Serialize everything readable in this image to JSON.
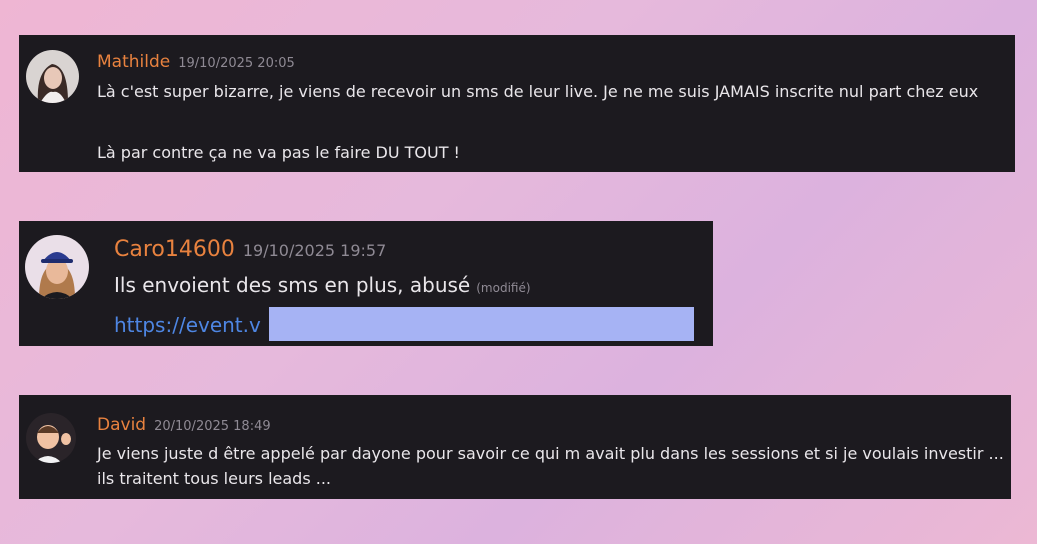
{
  "messages": [
    {
      "username": "Mathilde",
      "timestamp": "19/10/2025 20:05",
      "avatar": "woman-photo-avatar",
      "lines": [
        "Là c'est super bizarre, je viens de recevoir un sms de leur live. Je ne me suis JAMAIS inscrite nul part chez eux",
        "Là par contre ça ne va pas le faire DU TOUT !"
      ]
    },
    {
      "username": "Caro14600",
      "timestamp": "19/10/2025 19:57",
      "avatar": "memoji-avatar-blue-cap",
      "text": "Ils envoient des sms en plus,  abusé",
      "edited_label": "(modifié)",
      "link_visible": "https://event.v",
      "link_redacted": true
    },
    {
      "username": "David",
      "timestamp": "20/10/2025 18:49",
      "avatar": "memoji-avatar-waving",
      "text": "Je viens juste d être appelé par dayone pour savoir ce qui m avait plu dans les sessions et si je voulais investir ... ils traitent tous leurs leads ..."
    }
  ],
  "colors": {
    "username": "#e8823f",
    "timestamp": "#8f8a94",
    "message_text": "#e9e6ea",
    "card_bg": "#1c1a1f",
    "link": "#4e86e3",
    "redaction": "#a6b3f4"
  }
}
